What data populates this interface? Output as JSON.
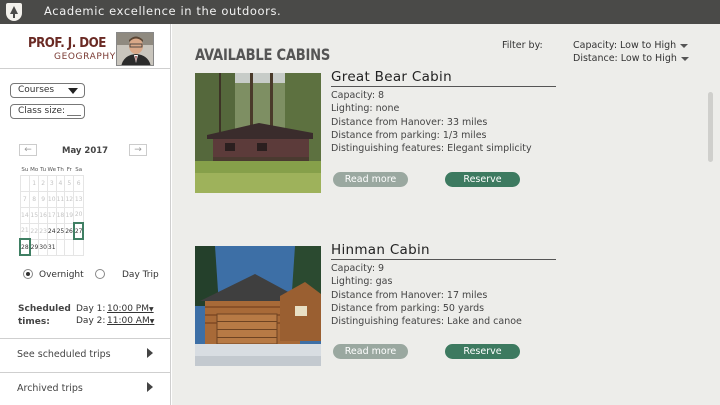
{
  "header": {
    "tagline": "Academic excellence in the outdoors."
  },
  "profile": {
    "name": "PROF. J. DOE",
    "department": "GEOGRAPHY"
  },
  "filters": {
    "courses_label": "Courses",
    "class_size_label": "Class size:",
    "class_size_value": ""
  },
  "calendar": {
    "month": "May 2017",
    "prev_icon": "arrow-left-icon",
    "next_icon": "arrow-right-icon",
    "weekdays": [
      "Su",
      "Mo",
      "Tu",
      "We",
      "Th",
      "Fr",
      "Sa"
    ],
    "weeks": [
      [
        "",
        "1",
        "2",
        "3",
        "4",
        "5",
        "6"
      ],
      [
        "7",
        "8",
        "9",
        "10",
        "11",
        "12",
        "13"
      ],
      [
        "14",
        "15",
        "16",
        "17",
        "18",
        "19",
        "20"
      ],
      [
        "21",
        "22",
        "23",
        "24",
        "25",
        "26",
        "27"
      ],
      [
        "28",
        "29",
        "30",
        "31",
        "",
        "",
        ""
      ]
    ],
    "selected": [
      "27",
      "28"
    ],
    "available_from": 24
  },
  "trip_type": {
    "overnight": "Overnight",
    "day_trip": "Day Trip",
    "selected": "overnight"
  },
  "schedule": {
    "label_line1": "Scheduled",
    "label_line2": "times:",
    "day1_label": "Day 1:",
    "day1_time": "10:00 PM",
    "day2_label": "Day 2:",
    "day2_time": "11:00 AM"
  },
  "nav": {
    "scheduled": "See scheduled trips",
    "archived": "Archived trips"
  },
  "main": {
    "heading": "AVAILABLE CABINS",
    "filter_by": "Filter by:",
    "filter_capacity": "Capacity: Low to High",
    "filter_distance": "Distance: Low to High"
  },
  "cabins": [
    {
      "name": "Great Bear Cabin",
      "capacity": "Capacity: 8",
      "lighting": "Lighting:  none",
      "hanover": "Distance from Hanover: 33 miles",
      "parking": "Distance from parking: 1/3 miles",
      "features": "Distinguishing features: Elegant simplicity",
      "read_more": "Read more",
      "reserve": "Reserve"
    },
    {
      "name": "Hinman Cabin",
      "capacity": "Capacity: 9",
      "lighting": "Lighting:  gas",
      "hanover": "Distance from Hanover: 17 miles",
      "parking": "Distance from parking: 50 yards",
      "features": "Distinguishing features: Lake and canoe",
      "read_more": "Read more",
      "reserve": "Reserve"
    }
  ]
}
